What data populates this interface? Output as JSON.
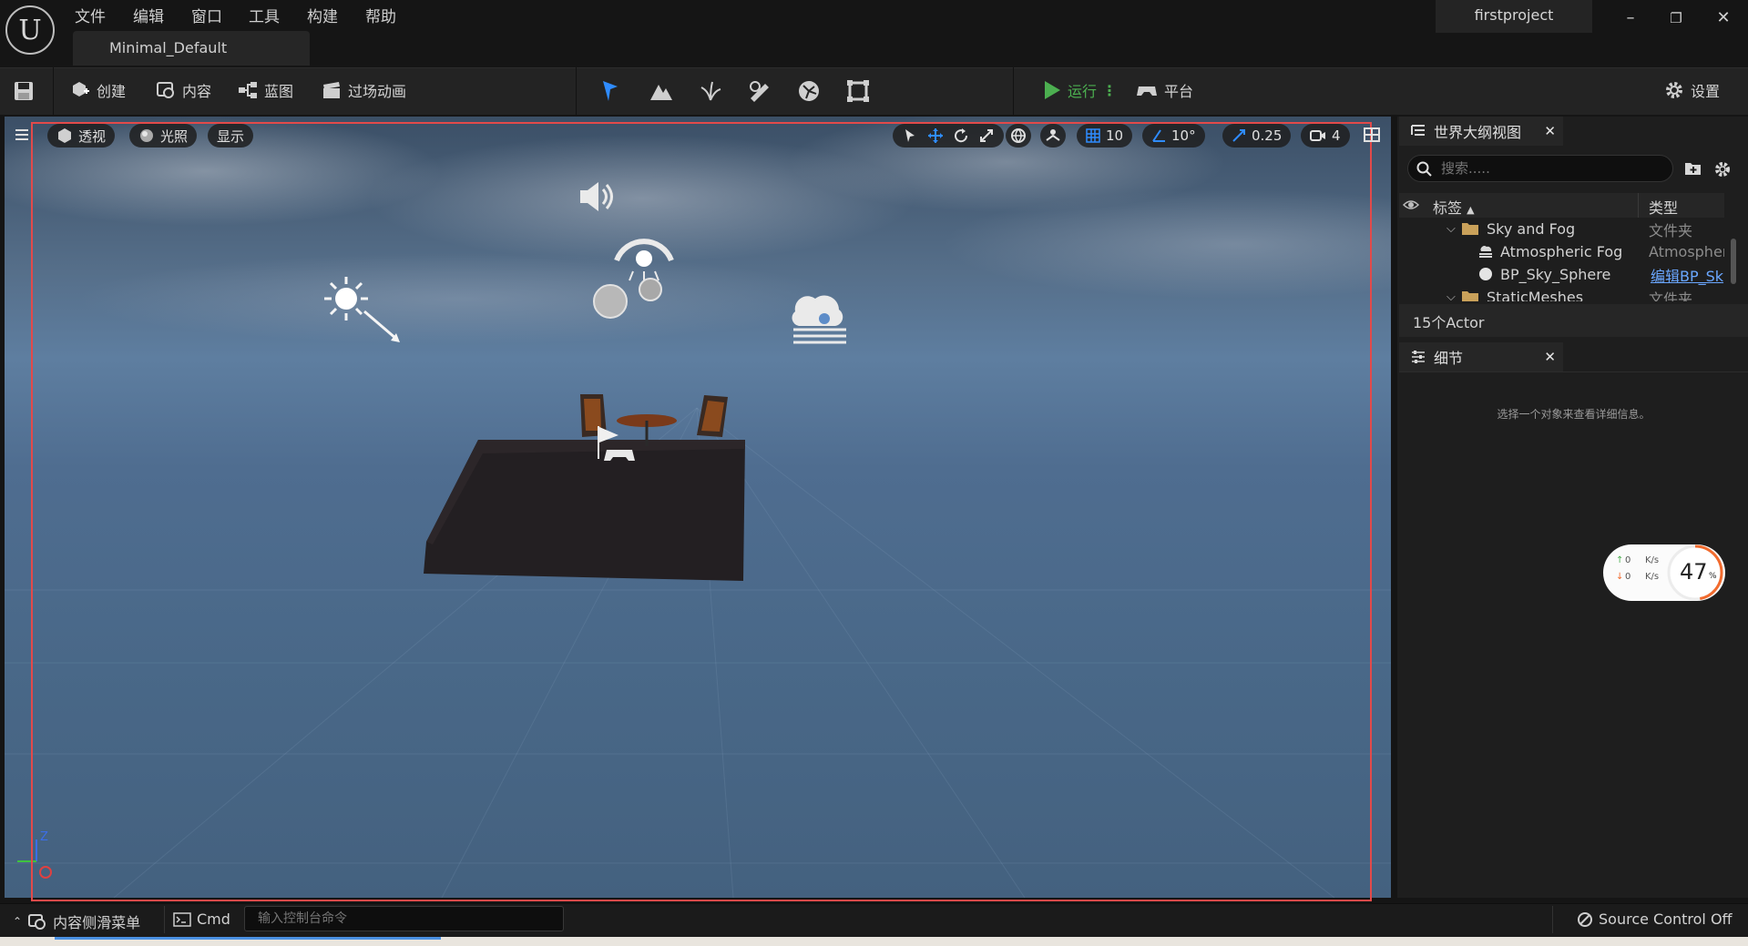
{
  "menu": {
    "items": [
      "文件",
      "编辑",
      "窗口",
      "工具",
      "构建",
      "帮助"
    ]
  },
  "document_tab": {
    "label": "Minimal_Default"
  },
  "project": {
    "name": "firstproject"
  },
  "window_controls": {
    "minimize": "–",
    "restore": "❐",
    "close": "✕"
  },
  "toolbar": {
    "create_label": "创建",
    "content_label": "内容",
    "blueprint_label": "蓝图",
    "cinematics_label": "过场动画",
    "play_label": "运行",
    "play_more": "⋮",
    "platforms_label": "平台",
    "settings_label": "设置"
  },
  "viewport": {
    "perspective_label": "透视",
    "lighting_label": "光照",
    "show_label": "显示",
    "grid_snap_value": "10",
    "rotation_snap_value": "10°",
    "scale_snap_value": "0.25",
    "camera_speed_value": "4",
    "axis_z_label": "Z"
  },
  "outliner": {
    "title": "世界大纲视图",
    "search_placeholder": "搜索.....",
    "col_label": "标签",
    "col_type": "类型",
    "rows": [
      {
        "name": "Sky and Fog",
        "type": "文件夹"
      },
      {
        "name": "Atmospheric Fog",
        "type": "Atmospher"
      },
      {
        "name": "BP_Sky_Sphere",
        "type": "编辑BP_Sk"
      },
      {
        "name": "StaticMeshes",
        "type": "文件夹"
      }
    ],
    "actor_count": "15个Actor"
  },
  "details": {
    "title": "细节",
    "empty_message": "选择一个对象来查看详细信息。"
  },
  "bottom_bar": {
    "content_drawer_label": "内容侧滑菜单",
    "cmd_label": "Cmd",
    "console_placeholder": "输入控制台命令",
    "source_control_label": "Source Control Off"
  },
  "net_widget": {
    "up_value": "0",
    "down_value": "0",
    "unit": "K/s",
    "percent_value": "47",
    "percent_sign": "%",
    "percent_fraction": 0.47
  },
  "colors": {
    "selection_frame": "#e24a4a",
    "play_green": "#4caf50",
    "link_blue": "#6aa7ff",
    "net_ring": "#f26b2e"
  }
}
